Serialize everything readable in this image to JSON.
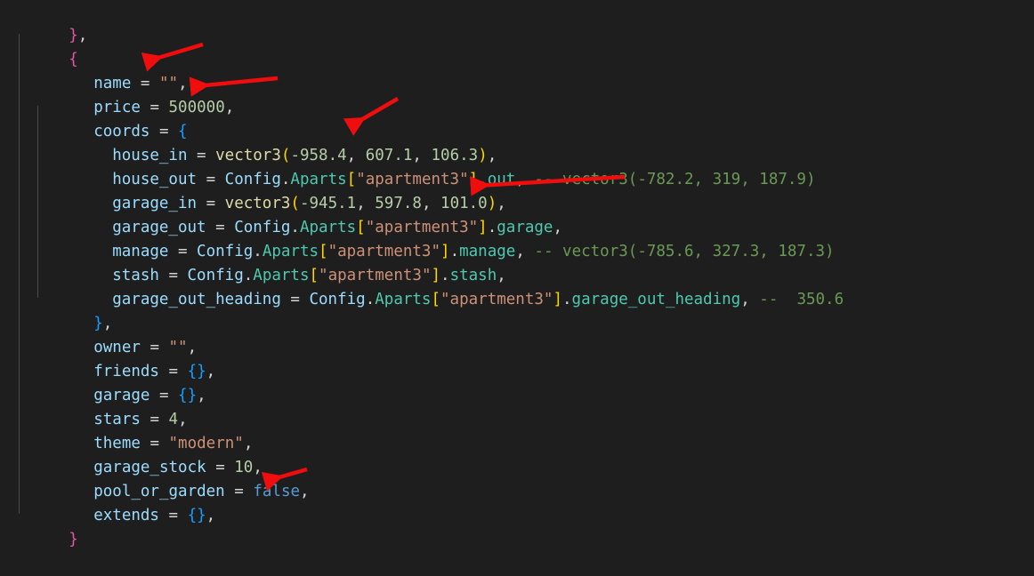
{
  "editor": {
    "background": "#1e1e1e",
    "language": "lua",
    "font_size_px": 17.5,
    "line_height_px": 27,
    "colors": {
      "property": "#9cdcfe",
      "number": "#b5cea8",
      "string": "#ce9178",
      "function": "#dcdcaa",
      "class": "#4ec9b0",
      "keyword": "#569cd6",
      "comment": "#6a9955",
      "brace_pink": "#e356a7",
      "brace_blue": "#179fff",
      "bracket_yellow": "#ffd700",
      "default_text": "#d4d4d4",
      "annotation_arrow": "#f00d0d"
    }
  },
  "code_lines": [
    {
      "id": "l01",
      "indent": 0,
      "text": "},"
    },
    {
      "id": "l02",
      "indent": 0,
      "text": "{"
    },
    {
      "id": "l03",
      "indent": 1,
      "text": "name = \"\","
    },
    {
      "id": "l04",
      "indent": 1,
      "text": "price = 500000,"
    },
    {
      "id": "l05",
      "indent": 1,
      "text": "coords = {"
    },
    {
      "id": "l06",
      "indent": 2,
      "text": "house_in = vector3(-958.4, 607.1, 106.3),"
    },
    {
      "id": "l07",
      "indent": 2,
      "text": "house_out = Config.Aparts[\"apartment3\"].out, -- vector3(-782.2, 319, 187.9)"
    },
    {
      "id": "l08",
      "indent": 2,
      "text": "garage_in = vector3(-945.1, 597.8, 101.0),"
    },
    {
      "id": "l09",
      "indent": 2,
      "text": "garage_out = Config.Aparts[\"apartment3\"].garage,"
    },
    {
      "id": "l10",
      "indent": 2,
      "text": "manage = Config.Aparts[\"apartment3\"].manage, -- vector3(-785.6, 327.3, 187.3)"
    },
    {
      "id": "l11",
      "indent": 2,
      "text": "stash = Config.Aparts[\"apartment3\"].stash,"
    },
    {
      "id": "l12",
      "indent": 2,
      "text": "garage_out_heading = Config.Aparts[\"apartment3\"].garage_out_heading, --  350.6"
    },
    {
      "id": "l13",
      "indent": 1,
      "text": "},"
    },
    {
      "id": "l14",
      "indent": 1,
      "text": "owner = \"\","
    },
    {
      "id": "l15",
      "indent": 1,
      "text": "friends = {},"
    },
    {
      "id": "l16",
      "indent": 1,
      "text": "garage = {},"
    },
    {
      "id": "l17",
      "indent": 1,
      "text": "stars = 4,"
    },
    {
      "id": "l18",
      "indent": 1,
      "text": "theme = \"modern\","
    },
    {
      "id": "l19",
      "indent": 1,
      "text": "garage_stock = 10,"
    },
    {
      "id": "l20",
      "indent": 1,
      "text": "pool_or_garden = false,"
    },
    {
      "id": "l21",
      "indent": 1,
      "text": "extends = {},"
    },
    {
      "id": "l22",
      "indent": 0,
      "text": "}"
    }
  ],
  "tokens": {
    "l01": {
      "brace": "}",
      "comma": ","
    },
    "l02": {
      "brace": "{"
    },
    "l03": {
      "key": "name",
      "eq": " = ",
      "value": "\"\"",
      "comma": ","
    },
    "l04": {
      "key": "price",
      "eq": " = ",
      "value": "500000",
      "comma": ","
    },
    "l05": {
      "key": "coords",
      "eq": " = ",
      "brace": "{"
    },
    "l06": {
      "key": "house_in",
      "eq": " = ",
      "fn": "vector3",
      "args": [
        "-958.4",
        "607.1",
        "106.3"
      ],
      "comma": ","
    },
    "l07": {
      "key": "house_out",
      "eq": " = ",
      "obj": "Config",
      "dot1": ".",
      "cls": "Aparts",
      "lb": "[",
      "str": "\"apartment3\"",
      "rb": "]",
      "dot2": ".",
      "prop": "out",
      "comma": ",",
      "comment": "-- vector3(-782.2, 319, 187.9)"
    },
    "l08": {
      "key": "garage_in",
      "eq": " = ",
      "fn": "vector3",
      "args": [
        "-945.1",
        "597.8",
        "101.0"
      ],
      "comma": ","
    },
    "l09": {
      "key": "garage_out",
      "eq": " = ",
      "obj": "Config",
      "dot1": ".",
      "cls": "Aparts",
      "lb": "[",
      "str": "\"apartment3\"",
      "rb": "]",
      "dot2": ".",
      "prop": "garage",
      "comma": ","
    },
    "l10": {
      "key": "manage",
      "eq": " = ",
      "obj": "Config",
      "dot1": ".",
      "cls": "Aparts",
      "lb": "[",
      "str": "\"apartment3\"",
      "rb": "]",
      "dot2": ".",
      "prop": "manage",
      "comma": ",",
      "comment": "-- vector3(-785.6, 327.3, 187.3)"
    },
    "l11": {
      "key": "stash",
      "eq": " = ",
      "obj": "Config",
      "dot1": ".",
      "cls": "Aparts",
      "lb": "[",
      "str": "\"apartment3\"",
      "rb": "]",
      "dot2": ".",
      "prop": "stash",
      "comma": ","
    },
    "l12": {
      "key": "garage_out_heading",
      "eq": " = ",
      "obj": "Config",
      "dot1": ".",
      "cls": "Aparts",
      "lb": "[",
      "str": "\"apartment3\"",
      "rb": "]",
      "dot2": ".",
      "prop": "garage_out_heading",
      "comma": ",",
      "comment": "--  350.6"
    },
    "l13": {
      "brace": "}",
      "comma": ","
    },
    "l14": {
      "key": "owner",
      "eq": " = ",
      "value": "\"\"",
      "comma": ","
    },
    "l15": {
      "key": "friends",
      "eq": " = ",
      "value": "{}",
      "comma": ","
    },
    "l16": {
      "key": "garage",
      "eq": " = ",
      "value": "{}",
      "comma": ","
    },
    "l17": {
      "key": "stars",
      "eq": " = ",
      "value": "4",
      "comma": ","
    },
    "l18": {
      "key": "theme",
      "eq": " = ",
      "value": "\"modern\"",
      "comma": ","
    },
    "l19": {
      "key": "garage_stock",
      "eq": " = ",
      "value": "10",
      "comma": ","
    },
    "l20": {
      "key": "pool_or_garden",
      "eq": " = ",
      "value": "false",
      "comma": ","
    },
    "l21": {
      "key": "extends",
      "eq": " = ",
      "value": "{}",
      "comma": ","
    },
    "l22": {
      "brace": "}"
    }
  },
  "annotations": {
    "color": "#f00d0d",
    "arrows": [
      {
        "name": "arrow-to-name-value",
        "points_at": "name = \"\"",
        "direction": "left"
      },
      {
        "name": "arrow-to-price-value",
        "points_at": "price = 500000",
        "direction": "left"
      },
      {
        "name": "arrow-to-house-in-coords",
        "points_at": "vector3(-958.4, 607.1, 106.3)",
        "direction": "down-left"
      },
      {
        "name": "arrow-to-garage-in-coords",
        "points_at": "vector3(-945.1, 597.8, 101.0)",
        "direction": "left"
      },
      {
        "name": "arrow-to-pool-or-garden",
        "points_at": "pool_or_garden = false",
        "direction": "left"
      }
    ]
  }
}
